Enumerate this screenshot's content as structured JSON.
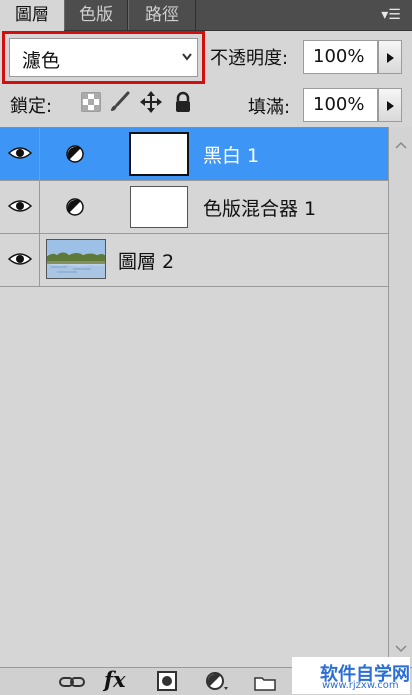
{
  "tabs": [
    {
      "label": "圖層",
      "active": true
    },
    {
      "label": "色版",
      "active": false
    },
    {
      "label": "路徑",
      "active": false
    }
  ],
  "panel_menu_icon": "panel-menu-icon",
  "blend_mode": {
    "value": "濾色"
  },
  "opacity": {
    "label": "不透明度:",
    "value": "100%"
  },
  "lock": {
    "label": "鎖定:",
    "icons": [
      "lock-transparent-icon",
      "lock-paint-icon",
      "lock-move-icon",
      "lock-all-icon"
    ]
  },
  "fill": {
    "label": "填滿:",
    "value": "100%"
  },
  "layers": [
    {
      "name": "黑白 1",
      "selected": true,
      "visible": true,
      "kind": "adjustment"
    },
    {
      "name": "色版混合器 1",
      "selected": false,
      "visible": true,
      "kind": "adjustment"
    },
    {
      "name": "圖層 2",
      "selected": false,
      "visible": true,
      "kind": "image"
    }
  ],
  "bottom_tools": [
    "link-layers-icon",
    "fx-icon",
    "add-mask-icon",
    "new-adjustment-icon",
    "new-group-icon",
    "new-layer-icon",
    "delete-icon"
  ],
  "bottom_fx_label": "fx",
  "watermark": {
    "main": "软件自学网",
    "sub": "www.rjzxw.com"
  },
  "colors": {
    "selection": "#3d96f5",
    "highlight_border": "#d20f0f",
    "panel_bg": "#d6d6d6",
    "tab_bar": "#4d4d4d"
  }
}
